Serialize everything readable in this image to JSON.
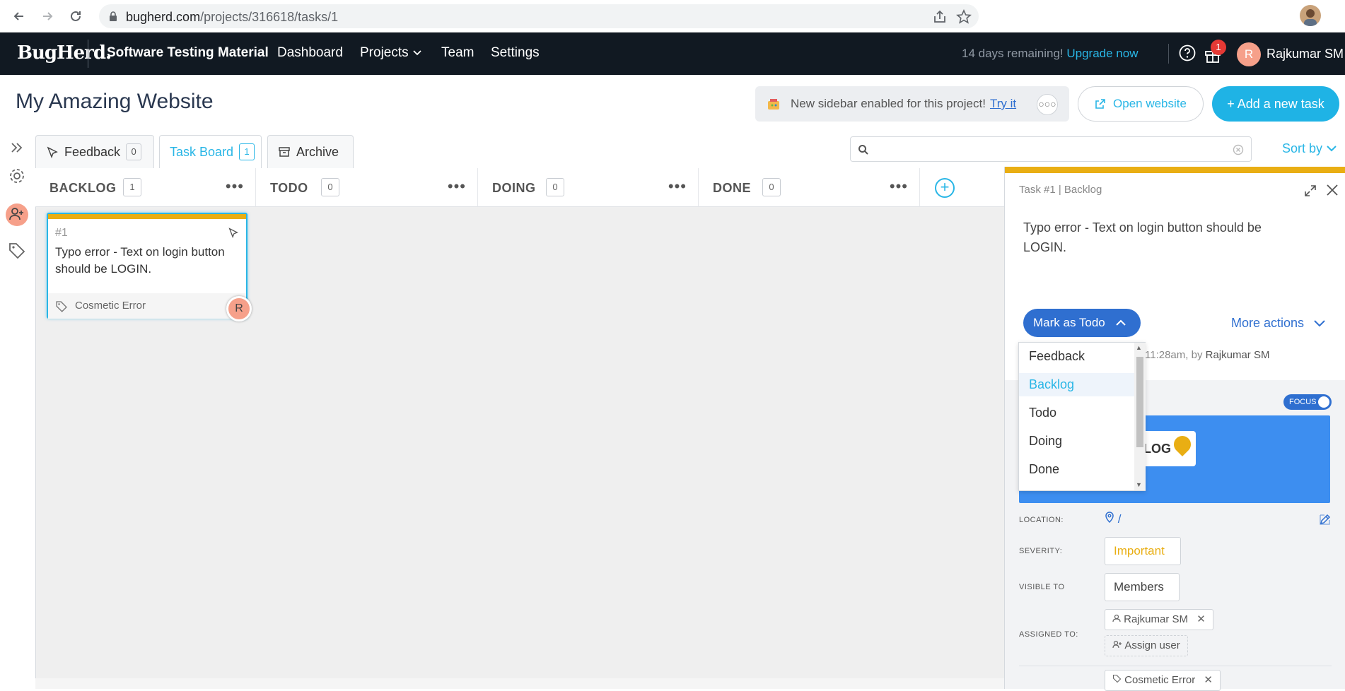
{
  "browser": {
    "url_host": "bugherd.com",
    "url_path": "/projects/316618/tasks/1"
  },
  "header": {
    "logo": "BugHerd.",
    "project_name": "Software Testing Material",
    "nav": [
      "Dashboard",
      "Projects",
      "Team",
      "Settings"
    ],
    "trial_text": "14 days remaining!",
    "upgrade_label": "Upgrade now",
    "gift_badge": "1",
    "user_initial": "R",
    "user_name": "Rajkumar SM"
  },
  "page": {
    "title": "My Amazing Website",
    "notice_text": "New sidebar enabled for this project!",
    "notice_link": "Try it",
    "open_website_label": "Open website",
    "add_task_label": "+ Add a new task"
  },
  "tabs": [
    {
      "label": "Feedback",
      "count": "0"
    },
    {
      "label": "Task Board",
      "count": "1"
    },
    {
      "label": "Archive"
    }
  ],
  "sort_label": "Sort by",
  "columns": [
    {
      "name": "BACKLOG",
      "count": "1"
    },
    {
      "name": "TODO",
      "count": "0"
    },
    {
      "name": "DOING",
      "count": "0"
    },
    {
      "name": "DONE",
      "count": "0"
    }
  ],
  "card": {
    "number": "#1",
    "text": "Typo error - Text on login button should be LOGIN.",
    "tag": "Cosmetic Error",
    "avatar": "R"
  },
  "panel": {
    "task_header": "Task #1 | Backlog",
    "description": "Typo error - Text on login button should be LOGIN.",
    "mark_label": "Mark as Todo",
    "more_actions": "More actions",
    "meta_time": "11:28am, by ",
    "meta_user": "Rajkumar SM",
    "focus_label": "FOCUS",
    "screenshot_text": "LOG",
    "location_label": "LOCATION:",
    "location_value": "/",
    "severity_label": "SEVERITY:",
    "severity_value": "Important",
    "visible_label": "VISIBLE TO",
    "visible_value": "Members",
    "assigned_label": "ASSIGNED TO:",
    "assigned_user": "Rajkumar SM",
    "assign_user_label": "Assign user",
    "tag_value": "Cosmetic Error"
  },
  "dropdown": {
    "options": [
      "Feedback",
      "Backlog",
      "Todo",
      "Doing",
      "Done"
    ],
    "selected": "Backlog"
  },
  "colors": {
    "accent": "#29b6e6",
    "primary": "#2f6fd0",
    "header_bg": "#111922",
    "card_bar": "#e9ae13",
    "severity": "#e9ae13"
  }
}
